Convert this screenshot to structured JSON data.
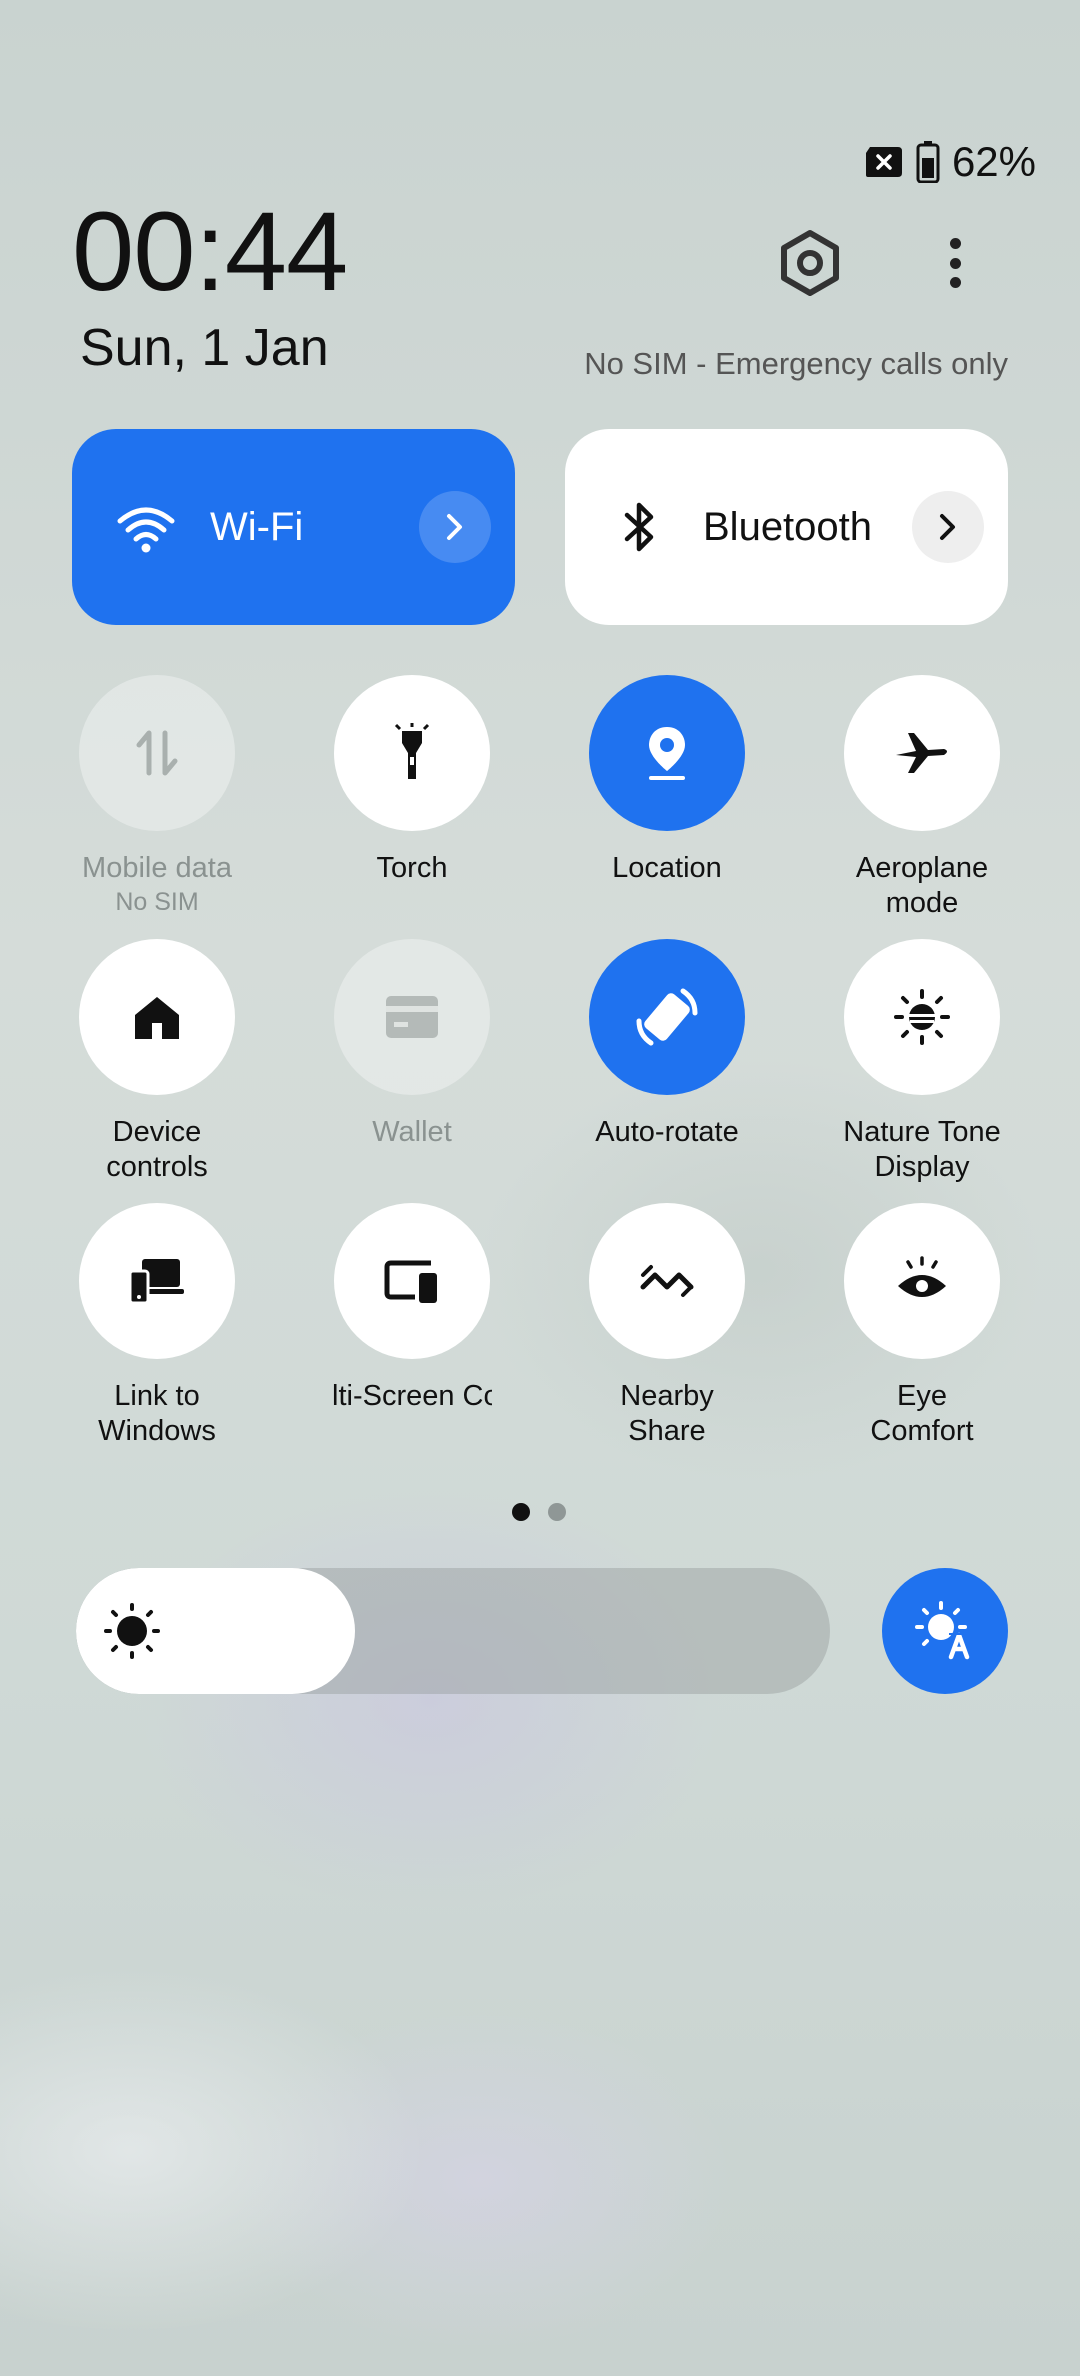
{
  "status_bar": {
    "battery": "62%",
    "no_sim_icon": "sim-card-x-icon",
    "battery_icon": "battery-icon"
  },
  "header": {
    "time": "00:44",
    "date": "Sun, 1 Jan",
    "sim_status": "No SIM - Emergency calls only"
  },
  "big_tiles": {
    "wifi": {
      "label": "Wi-Fi",
      "active": true
    },
    "bluetooth": {
      "label": "Bluetooth",
      "active": false
    }
  },
  "tiles": [
    {
      "label": "Mobile data",
      "sub": "No SIM",
      "state": "unavailable",
      "icon": "mobile-data-icon"
    },
    {
      "label": "Torch",
      "state": "off",
      "icon": "torch-icon"
    },
    {
      "label": "Location",
      "state": "on",
      "icon": "location-pin-icon"
    },
    {
      "label": "Aeroplane mode",
      "state": "off",
      "icon": "airplane-icon"
    },
    {
      "label": "Device controls",
      "state": "off",
      "icon": "home-icon"
    },
    {
      "label": "Wallet",
      "state": "unavailable",
      "icon": "wallet-card-icon"
    },
    {
      "label": "Auto-rotate",
      "state": "on",
      "icon": "auto-rotate-icon"
    },
    {
      "label": "Nature Tone Display",
      "state": "off",
      "icon": "nature-tone-icon"
    },
    {
      "label": "Link to Windows",
      "state": "off",
      "icon": "link-to-windows-icon"
    },
    {
      "label": "lti-Screen Co",
      "state": "off",
      "icon": "multi-screen-icon"
    },
    {
      "label": "Nearby Share",
      "state": "off",
      "icon": "nearby-share-icon"
    },
    {
      "label": "Eye Comfort",
      "state": "off",
      "icon": "eye-comfort-icon"
    }
  ],
  "pager": {
    "pages": 2,
    "current": 1
  },
  "brightness": {
    "level": 0.37,
    "auto_brightness": true
  },
  "colors": {
    "accent": "#1f72ef",
    "tile": "#ffffff"
  }
}
